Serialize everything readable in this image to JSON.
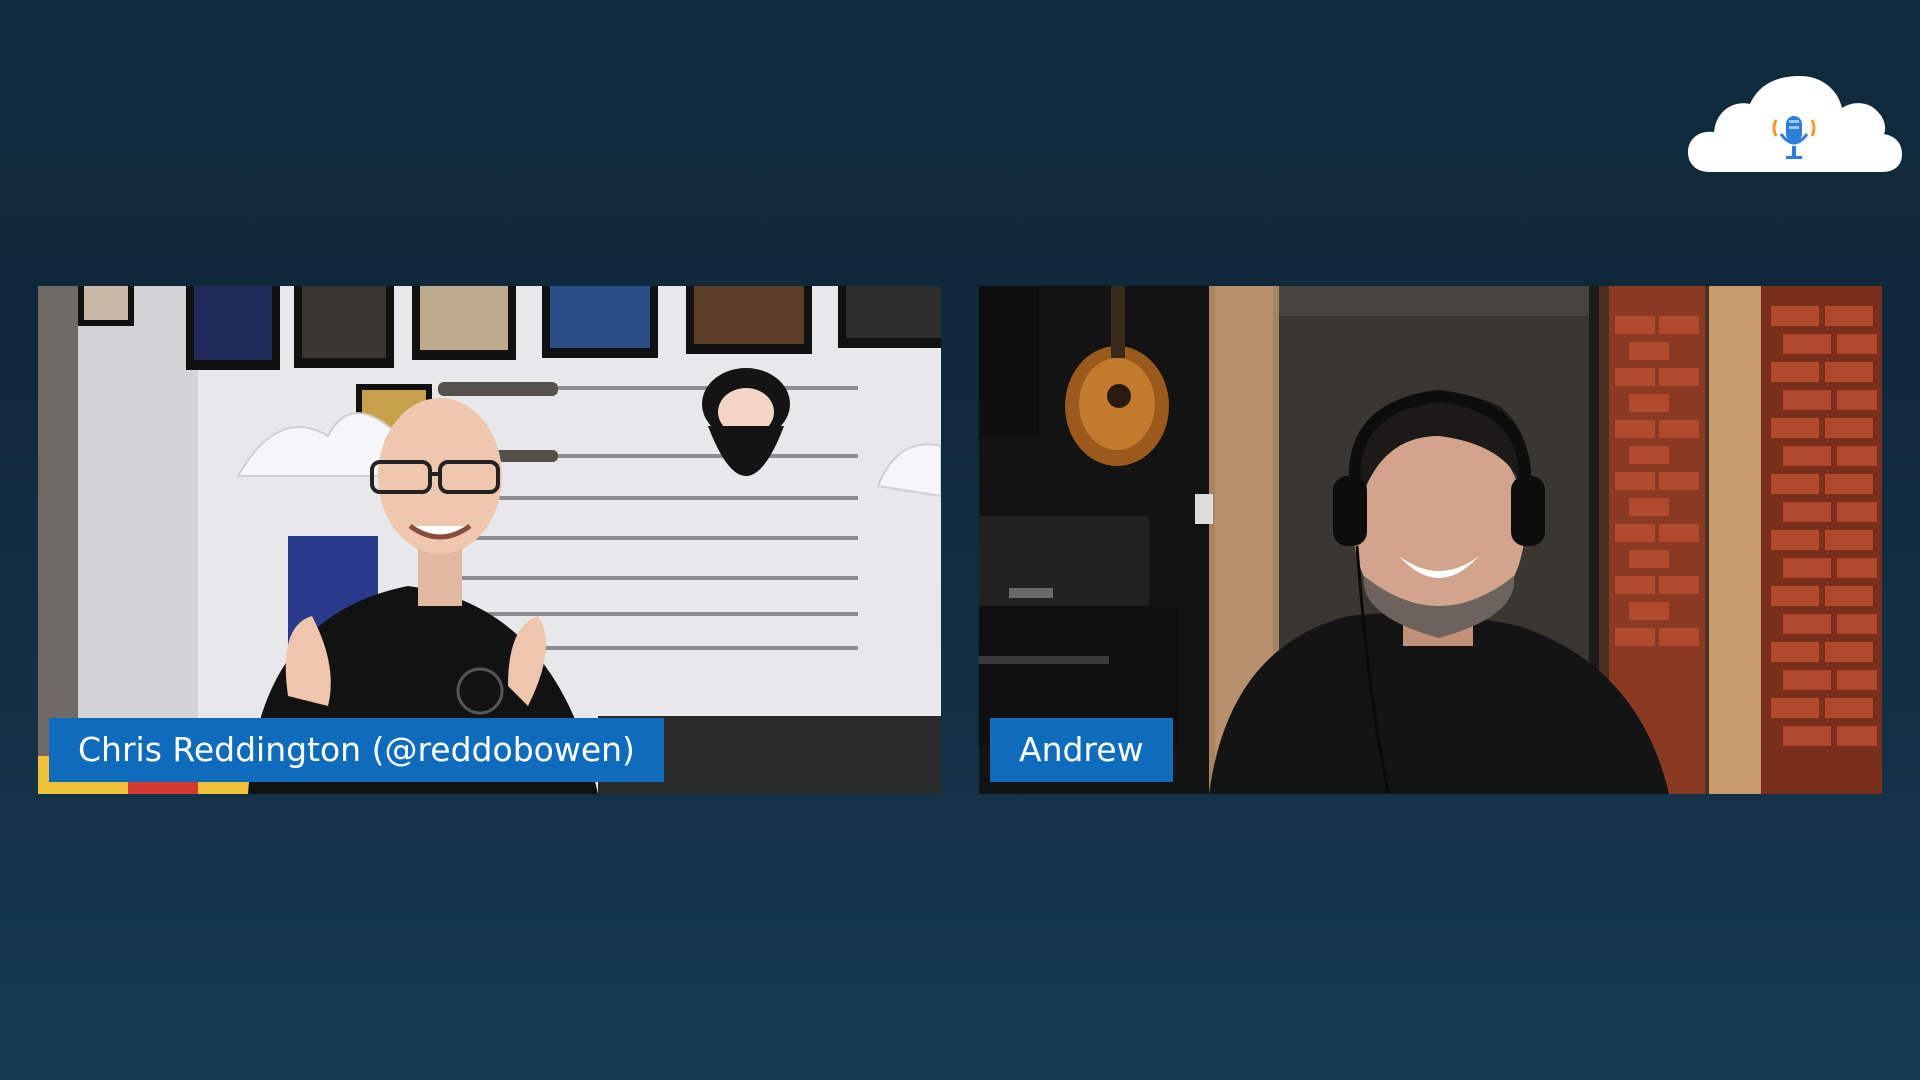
{
  "participants": [
    {
      "id": "left",
      "name": "Chris Reddington (@reddobowen)"
    },
    {
      "id": "right",
      "name": "Andrew"
    }
  ],
  "logo": {
    "icon": "cloud-microphone-icon"
  },
  "colors": {
    "background_top": "#0f2a3b",
    "background_bottom": "#163a52",
    "label_blue": "#0f6cbd",
    "label_text": "#ffffff"
  }
}
